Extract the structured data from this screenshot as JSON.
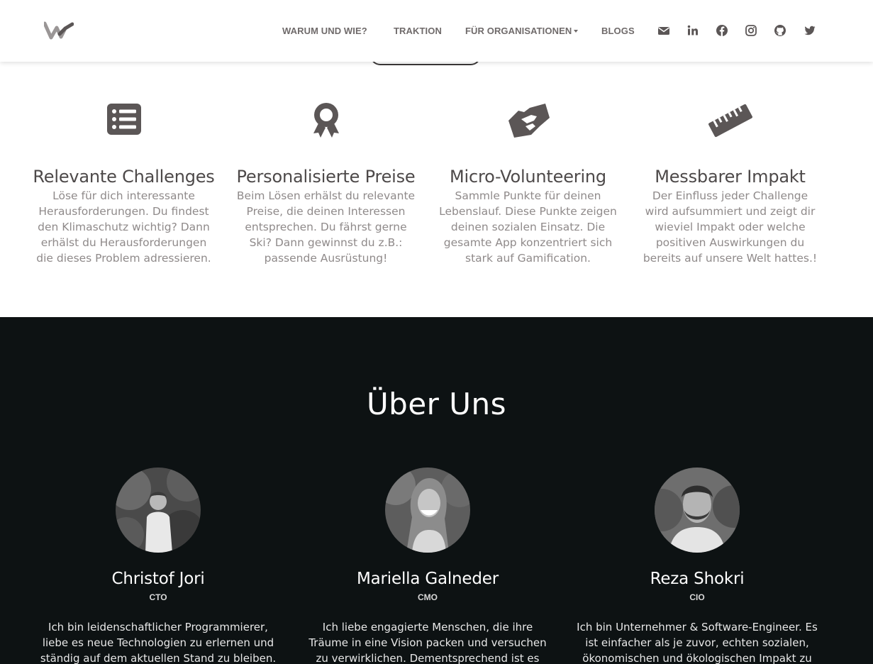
{
  "navbar": {
    "logo_icon": "wave-w-logo",
    "links": [
      {
        "label": "WARUM UND WIE?"
      },
      {
        "label": "TRAKTION"
      },
      {
        "label": "FÜR ORGANISATIONEN",
        "has_dropdown": true
      },
      {
        "label": "BLOGS"
      }
    ],
    "social_icons": [
      "envelope-icon",
      "linkedin-icon",
      "facebook-icon",
      "instagram-icon",
      "github-icon",
      "twitter-icon"
    ]
  },
  "features": [
    {
      "icon": "list-icon",
      "title": "Relevante Challenges",
      "text": "Löse für dich interessante Herausforderungen. Du findest den Klimaschutz wichtig? Dann erhälst du Herausforderungen die dieses Problem adressieren."
    },
    {
      "icon": "award-icon",
      "title": "Personalisierte Preise",
      "text": "Beim Lösen erhälst du relevante Preise, die deinen Interessen entsprechen. Du fährst gerne Ski? Dann gewinnst du z.B.: passende Ausrüstung!"
    },
    {
      "icon": "handshake-icon",
      "title": "Micro-Volunteering",
      "text": "Sammle Punkte für deinen Lebenslauf. Diese Punkte zeigen deinen sozialen Einsatz. Die gesamte App konzentriert sich stark auf Gamification."
    },
    {
      "icon": "ruler-icon",
      "title": "Messbarer Impakt",
      "text": "Der Einfluss jeder Challenge wird aufsummiert und zeigt dir wieviel Impakt oder welche positiven Auswirkungen du bereits auf unsere Welt hattes.!"
    }
  ],
  "about": {
    "title": "Über Uns",
    "members": [
      {
        "name": "Christof Jori",
        "role": "CTO",
        "bio": "Ich bin leidenschaftlicher Programmierer, liebe es neue Technologien zu erlernen und ständig auf dem aktuellen Stand zu bleiben."
      },
      {
        "name": "Mariella Galneder",
        "role": "CMO",
        "bio": "Ich liebe engagierte Menschen, die ihre Träume in eine Vision packen und versuchen zu verwirklichen. Dementsprechend ist es mir"
      },
      {
        "name": "Reza Shokri",
        "role": "CIO",
        "bio": "Ich bin Unternehmer & Software-Engineer. Es ist einfacher als je zuvor, echten sozialen, ökonomischen und ökologischen Impakt zu"
      }
    ]
  },
  "colors": {
    "icon_gray": "#5b5656",
    "dark_bg": "#0d1213",
    "nav_text": "#6f6a6a"
  }
}
